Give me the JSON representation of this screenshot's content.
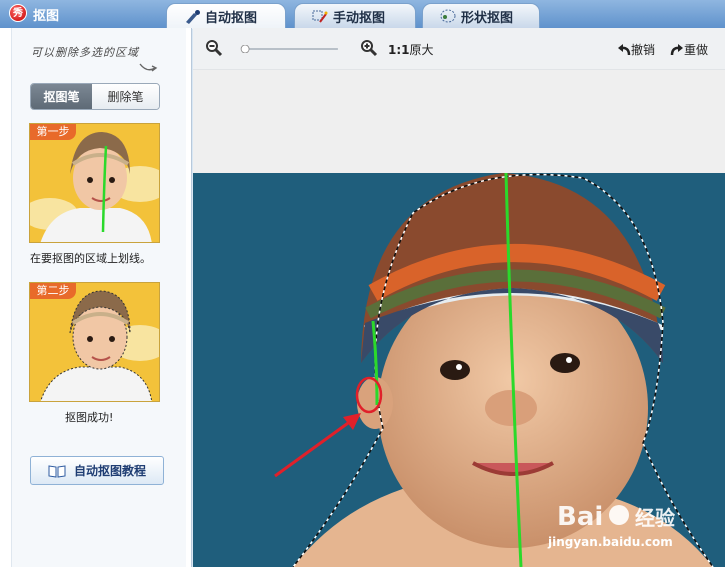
{
  "app": {
    "title": "抠图",
    "logo_char": "秀"
  },
  "tabs": [
    {
      "label": "自动抠图",
      "icon": "brush-icon",
      "active": true
    },
    {
      "label": "手动抠图",
      "icon": "magic-wand-icon",
      "active": false
    },
    {
      "label": "形状抠图",
      "icon": "lasso-shape-icon",
      "active": false
    }
  ],
  "sidebar": {
    "hint": "可以删除多选的区域",
    "mode": {
      "left": "抠图笔",
      "right": "删除笔",
      "selected": "抠图笔"
    },
    "step1": {
      "badge": "第一步",
      "caption": "在要抠图的区域上划线。"
    },
    "step2": {
      "badge": "第二步",
      "caption": "抠图成功!"
    },
    "tutorial_label": "自动抠图教程"
  },
  "toolbar": {
    "ratio_bold": "1:1",
    "ratio_label": "原大",
    "undo_label": "撤销",
    "redo_label": "重做"
  },
  "watermark": {
    "text": "Bai 经验",
    "url": "jingyan.baidu.com"
  },
  "colors": {
    "accent": "#5f92cc",
    "stroke_green": "#2bd92b",
    "annotation_red": "#e0202a",
    "photo_bg": "#1f5e7c"
  }
}
